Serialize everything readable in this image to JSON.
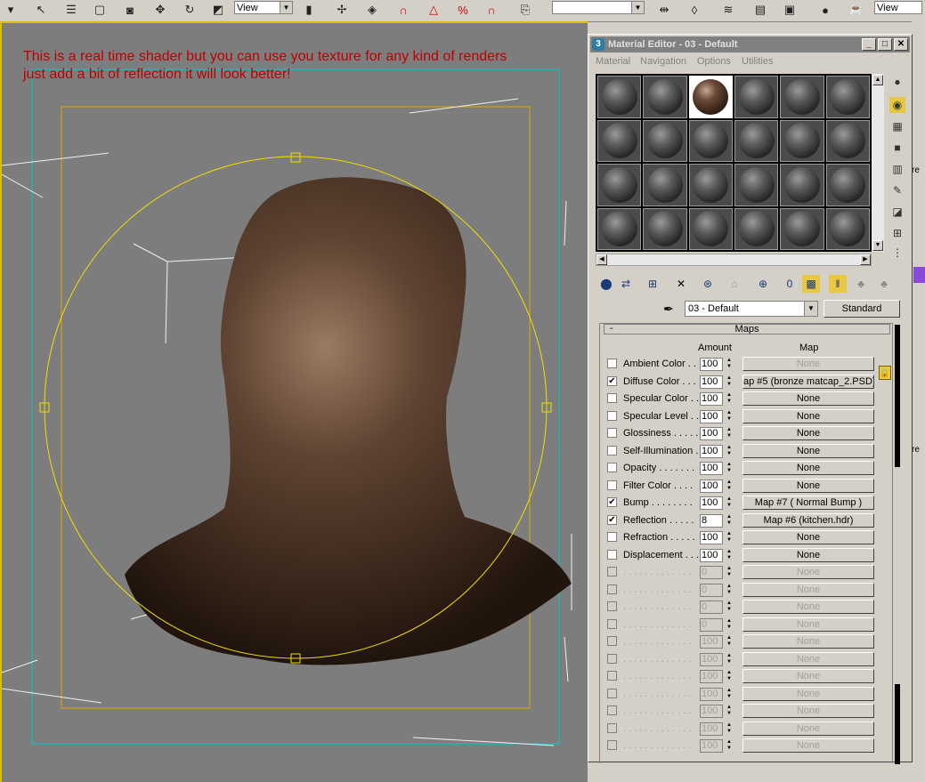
{
  "toolbar": {
    "view_label_1": "View",
    "view_label_2": "View",
    "icons": [
      "select-icon",
      "select-by-name-icon",
      "region-select-icon",
      "window-crossing-icon",
      "move-icon",
      "rotate-icon",
      "scale-icon",
      "reference-coord-icon",
      "pivot-icon",
      "snap-3d-icon",
      "angle-snap-icon",
      "percent-snap-icon",
      "spinner-snap-icon",
      "named-selection-icon",
      "mirror-icon",
      "align-icon",
      "layers-icon",
      "curve-editor-icon",
      "schematic-icon",
      "material-editor-icon",
      "render-setup-icon"
    ]
  },
  "viewport": {
    "overlay_line_1": "This is a real time shader but you can use you texture for any kind of renders",
    "overlay_line_2": "just add a bit of reflection it will look better!",
    "colors": {
      "background": "#7d7d7d",
      "overlay_text": "#c00000",
      "safe_frame": "#e0a800",
      "outer_frame": "#00c8d8",
      "gizmo": "#f0e000"
    }
  },
  "material_editor": {
    "title": "Material Editor - 03 - Default",
    "app_icon": "3",
    "menu": [
      "Material",
      "Navigation",
      "Options",
      "Utilities"
    ],
    "sample_slots": {
      "rows": 4,
      "cols": 6,
      "active_index": 2
    },
    "material_name": "03 - Default",
    "material_type": "Standard",
    "maps_rollout_title": "Maps",
    "col_amount": "Amount",
    "col_map": "Map",
    "rows": [
      {
        "label": "Ambient Color . . .",
        "checked": false,
        "enabled": true,
        "amount": "100",
        "map": "None",
        "map_disabled": true
      },
      {
        "label": "Diffuse Color . . .",
        "checked": true,
        "enabled": true,
        "amount": "100",
        "map": "ap #5 (bronze matcap_2.PSD)",
        "map_disabled": false
      },
      {
        "label": "Specular Color . .",
        "checked": false,
        "enabled": true,
        "amount": "100",
        "map": "None",
        "map_disabled": false
      },
      {
        "label": "Specular Level . .",
        "checked": false,
        "enabled": true,
        "amount": "100",
        "map": "None",
        "map_disabled": false
      },
      {
        "label": "Glossiness . . . . .",
        "checked": false,
        "enabled": true,
        "amount": "100",
        "map": "None",
        "map_disabled": false
      },
      {
        "label": "Self-Illumination .",
        "checked": false,
        "enabled": true,
        "amount": "100",
        "map": "None",
        "map_disabled": false
      },
      {
        "label": "Opacity . . . . . . .",
        "checked": false,
        "enabled": true,
        "amount": "100",
        "map": "None",
        "map_disabled": false
      },
      {
        "label": "Filter Color . . . .",
        "checked": false,
        "enabled": true,
        "amount": "100",
        "map": "None",
        "map_disabled": false
      },
      {
        "label": "Bump . . . . . . . .",
        "checked": true,
        "enabled": true,
        "amount": "100",
        "map": "Map #7  ( Normal Bump )",
        "map_disabled": false
      },
      {
        "label": "Reflection . . . . .",
        "checked": true,
        "enabled": true,
        "amount": "8",
        "map": "Map #6 (kitchen.hdr)",
        "map_disabled": false
      },
      {
        "label": "Refraction . . . . .",
        "checked": false,
        "enabled": true,
        "amount": "100",
        "map": "None",
        "map_disabled": false
      },
      {
        "label": "Displacement . . .",
        "checked": false,
        "enabled": true,
        "amount": "100",
        "map": "None",
        "map_disabled": false
      },
      {
        "label": ". . . . . . . . . . . . .",
        "checked": false,
        "enabled": false,
        "amount": "0",
        "map": "None",
        "map_disabled": true
      },
      {
        "label": ". . . . . . . . . . . . .",
        "checked": false,
        "enabled": false,
        "amount": "0",
        "map": "None",
        "map_disabled": true
      },
      {
        "label": ". . . . . . . . . . . . .",
        "checked": false,
        "enabled": false,
        "amount": "0",
        "map": "None",
        "map_disabled": true
      },
      {
        "label": ". . . . . . . . . . . . .",
        "checked": false,
        "enabled": false,
        "amount": "0",
        "map": "None",
        "map_disabled": true
      },
      {
        "label": ". . . . . . . . . . . . .",
        "checked": false,
        "enabled": false,
        "amount": "100",
        "map": "None",
        "map_disabled": true
      },
      {
        "label": ". . . . . . . . . . . . .",
        "checked": false,
        "enabled": false,
        "amount": "100",
        "map": "None",
        "map_disabled": true
      },
      {
        "label": ". . . . . . . . . . . . .",
        "checked": false,
        "enabled": false,
        "amount": "100",
        "map": "None",
        "map_disabled": true
      },
      {
        "label": ". . . . . . . . . . . . .",
        "checked": false,
        "enabled": false,
        "amount": "100",
        "map": "None",
        "map_disabled": true
      },
      {
        "label": ". . . . . . . . . . . . .",
        "checked": false,
        "enabled": false,
        "amount": "100",
        "map": "None",
        "map_disabled": true
      },
      {
        "label": ". . . . . . . . . . . . .",
        "checked": false,
        "enabled": false,
        "amount": "100",
        "map": "None",
        "map_disabled": true
      },
      {
        "label": ". . . . . . . . . . . . .",
        "checked": false,
        "enabled": false,
        "amount": "100",
        "map": "None",
        "map_disabled": true
      }
    ]
  },
  "right_strip": {
    "fragment_re": "re",
    "fragment_re2": "re"
  }
}
